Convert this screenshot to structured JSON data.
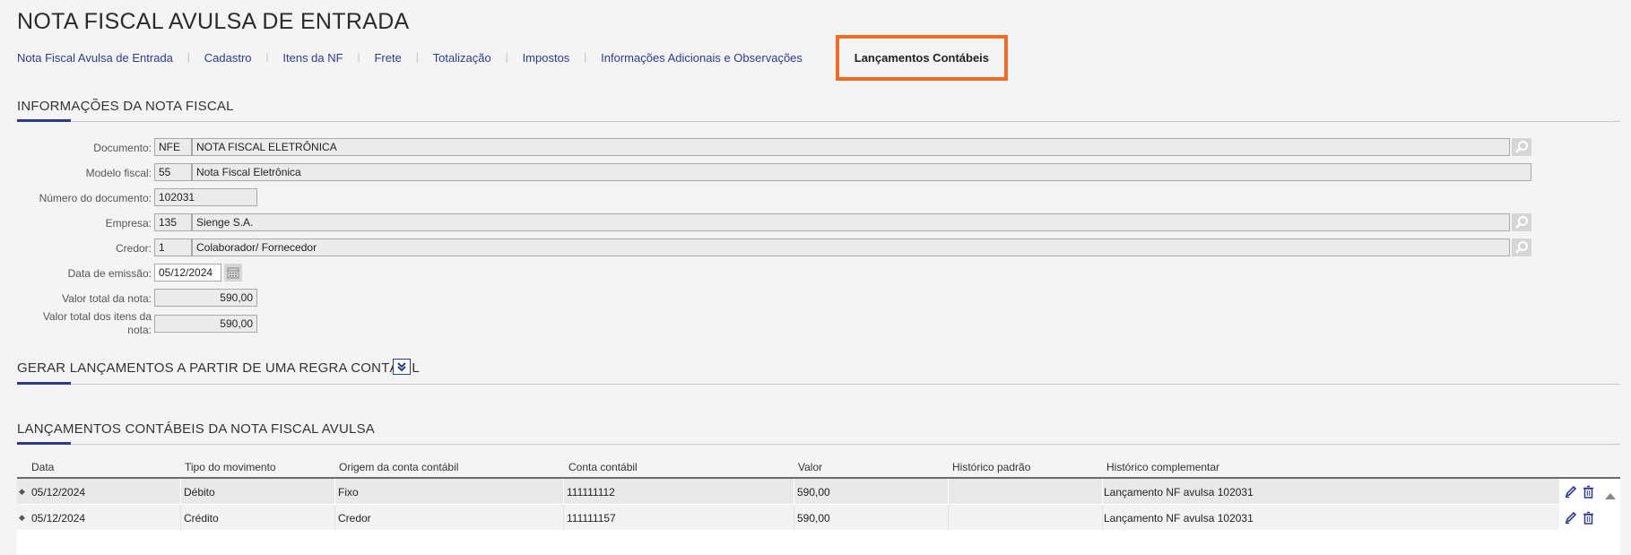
{
  "page": {
    "title": "NOTA FISCAL AVULSA DE ENTRADA"
  },
  "tabs": [
    {
      "label": "Nota Fiscal Avulsa de Entrada"
    },
    {
      "label": "Cadastro"
    },
    {
      "label": "Itens da NF"
    },
    {
      "label": "Frete"
    },
    {
      "label": "Totalização"
    },
    {
      "label": "Impostos"
    },
    {
      "label": "Informações Adicionais e Observações"
    },
    {
      "label": "Lançamentos Contábeis",
      "active": true
    }
  ],
  "info_section": {
    "title": "INFORMAÇÕES DA NOTA FISCAL",
    "documento": {
      "label": "Documento:",
      "code": "NFE",
      "name": "NOTA FISCAL ELETRÔNICA"
    },
    "modelo": {
      "label": "Modelo fiscal:",
      "code": "55",
      "name": "Nota Fiscal Eletrônica"
    },
    "numero": {
      "label": "Número do documento:",
      "value": "102031"
    },
    "empresa": {
      "label": "Empresa:",
      "code": "135",
      "name": "Sienge S.A."
    },
    "credor": {
      "label": "Credor:",
      "code": "1",
      "name": "Colaborador/ Fornecedor"
    },
    "data_emissao": {
      "label": "Data de emissão:",
      "value": "05/12/2024"
    },
    "valor_total": {
      "label": "Valor total da nota:",
      "value": "590,00"
    },
    "valor_itens": {
      "label_line1": "Valor total dos itens da",
      "label_line2": "nota:",
      "value": "590,00"
    }
  },
  "regra_section": {
    "title": "GERAR LANÇAMENTOS A PARTIR DE UMA REGRA CONTÁBIL"
  },
  "lanc_section": {
    "title": "LANÇAMENTOS CONTÁBEIS DA NOTA FISCAL AVULSA",
    "columns": [
      "Data",
      "Tipo do movimento",
      "Origem da conta contábil",
      "Conta contábil",
      "Valor",
      "Histórico padrão",
      "Histórico complementar"
    ],
    "rows": [
      {
        "data": "05/12/2024",
        "tipo": "Débito",
        "origem": "Fixo",
        "conta": "111111112",
        "valor": "590,00",
        "hist_padrao": "",
        "hist_comp": "Lançamento NF avulsa 102031"
      },
      {
        "data": "05/12/2024",
        "tipo": "Crédito",
        "origem": "Credor",
        "conta": "111111157",
        "valor": "590,00",
        "hist_padrao": "",
        "hist_comp": "Lançamento NF avulsa 102031"
      }
    ]
  },
  "colors": {
    "accent": "#2d3a8c",
    "highlight": "#f06a22"
  }
}
